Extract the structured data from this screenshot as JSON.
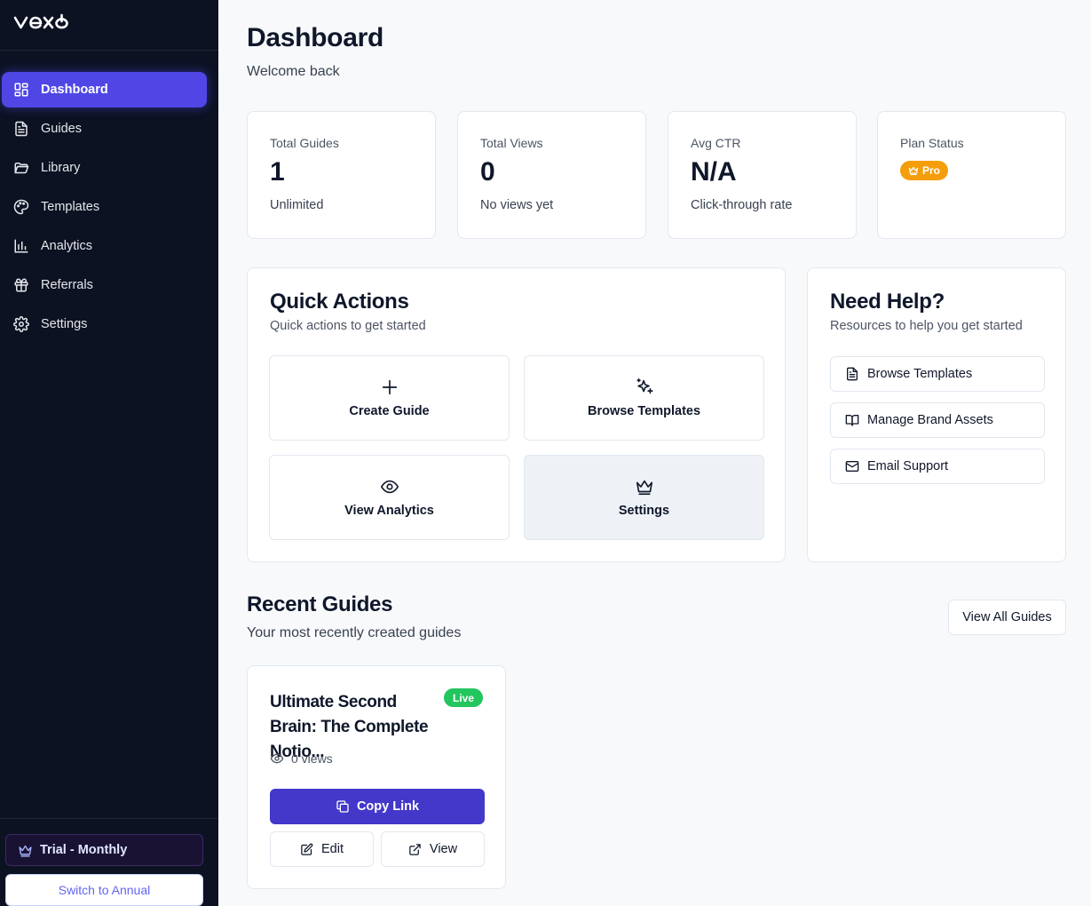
{
  "app": {
    "logo_text": "vexo"
  },
  "sidebar": {
    "items": [
      {
        "label": "Dashboard",
        "icon": "dashboard-icon",
        "active": true
      },
      {
        "label": "Guides",
        "icon": "document-icon"
      },
      {
        "label": "Library",
        "icon": "folder-icon"
      },
      {
        "label": "Templates",
        "icon": "palette-icon"
      },
      {
        "label": "Analytics",
        "icon": "bar-chart-icon"
      },
      {
        "label": "Referrals",
        "icon": "gift-icon"
      },
      {
        "label": "Settings",
        "icon": "gear-icon"
      }
    ],
    "plan_label": "Trial - Monthly",
    "switch_label": "Switch to Annual"
  },
  "header": {
    "title": "Dashboard",
    "subtitle": "Welcome back"
  },
  "stats": [
    {
      "label": "Total Guides",
      "value": "1",
      "sub": "Unlimited"
    },
    {
      "label": "Total Views",
      "value": "0",
      "sub": "No views yet"
    },
    {
      "label": "Avg CTR",
      "value": "N/A",
      "sub": "Click-through rate"
    },
    {
      "label": "Plan Status",
      "badge": "Pro"
    }
  ],
  "quick_actions": {
    "title": "Quick Actions",
    "subtitle": "Quick actions to get started",
    "items": [
      {
        "label": "Create Guide",
        "icon": "plus-icon"
      },
      {
        "label": "Browse Templates",
        "icon": "sparkles-icon"
      },
      {
        "label": "View Analytics",
        "icon": "eye-icon"
      },
      {
        "label": "Settings",
        "icon": "crown-icon"
      }
    ]
  },
  "help": {
    "title": "Need Help?",
    "subtitle": "Resources to help you get started",
    "items": [
      {
        "label": "Browse Templates",
        "icon": "document-icon"
      },
      {
        "label": "Manage Brand Assets",
        "icon": "book-icon"
      },
      {
        "label": "Email Support",
        "icon": "mail-icon"
      }
    ]
  },
  "recent": {
    "title": "Recent Guides",
    "subtitle": "Your most recently created guides",
    "view_all_label": "View All Guides",
    "guides": [
      {
        "title": "Ultimate Second Brain: The Complete Notio...",
        "status": "Live",
        "views": "0 views",
        "copy_label": "Copy Link",
        "edit_label": "Edit",
        "view_label": "View"
      }
    ]
  },
  "colors": {
    "sidebar_bg": "#0c1222",
    "accent": "#4f46e5",
    "pro_badge": "#f59e0b",
    "live_badge": "#22c55e",
    "copy_button": "#4338ca"
  }
}
